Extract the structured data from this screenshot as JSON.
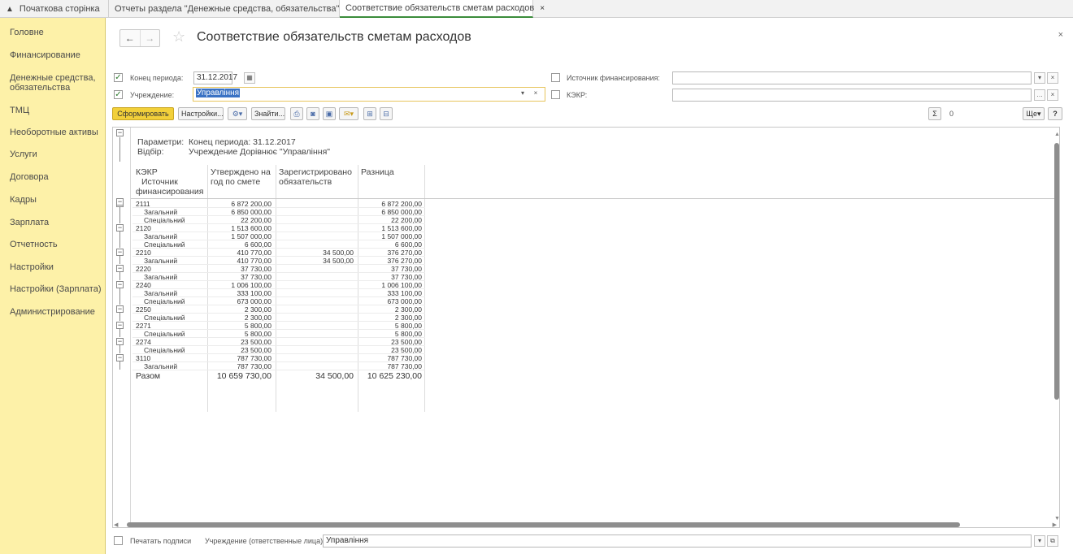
{
  "tabs": [
    {
      "label": "Початкова сторінка",
      "icon": "home-icon"
    },
    {
      "label": "Отчеты раздела \"Денежные средства, обязательства\"",
      "close": "×"
    },
    {
      "label": "Соответствие обязательств сметам расходов",
      "close": "×"
    }
  ],
  "sidebar": {
    "items": [
      "Головне",
      "Финансирование",
      "Денежные средства, обязательства",
      "ТМЦ",
      "Необоротные активы",
      "Услуги",
      "Договора",
      "Кадры",
      "Зарплата",
      "Отчетность",
      "Настройки",
      "Настройки (Зарплата)",
      "Администрирование"
    ]
  },
  "header": {
    "back": "←",
    "forward": "→",
    "star": "☆",
    "title": "Соответствие обязательств сметам расходов",
    "close": "×"
  },
  "filters": {
    "period_label": "Конец периода:",
    "period_value": "31.12.2017",
    "period_checked": true,
    "org_label": "Учреждение:",
    "org_value": "Управління",
    "org_checked": true,
    "source_label": "Источник финансирования:",
    "source_value": "",
    "source_checked": false,
    "kekr_label": "КЭКР:",
    "kekr_value": "",
    "kekr_checked": false
  },
  "toolbar": {
    "generate": "Сформировать",
    "settings": "Настройки...",
    "find": "Знайти...",
    "sum_value": "0",
    "more": "Ще",
    "help": "?"
  },
  "report": {
    "params_label": "Параметри:",
    "params_value": "Конец периода: 31.12.2017",
    "filter_label": "Відбір:",
    "filter_value": "Учреждение Дорівнює \"Управління\"",
    "columns": {
      "c1a": "КЭКР",
      "c1b": "Источник",
      "c1c": "финансирования",
      "c2a": "Утверждено на",
      "c2b": "год по смете",
      "c3a": "Зарегистрировано",
      "c3b": "обязательств",
      "c4": "Разница"
    },
    "rows": [
      {
        "name": "2111",
        "approved": "6 872 200,00",
        "registered": "",
        "diff": "6 872 200,00",
        "level": 0
      },
      {
        "name": "Загальний",
        "approved": "6 850 000,00",
        "registered": "",
        "diff": "6 850 000,00",
        "level": 1
      },
      {
        "name": "Спеціальний",
        "approved": "22 200,00",
        "registered": "",
        "diff": "22 200,00",
        "level": 1
      },
      {
        "name": "2120",
        "approved": "1 513 600,00",
        "registered": "",
        "diff": "1 513 600,00",
        "level": 0
      },
      {
        "name": "Загальний",
        "approved": "1 507 000,00",
        "registered": "",
        "diff": "1 507 000,00",
        "level": 1
      },
      {
        "name": "Спеціальний",
        "approved": "6 600,00",
        "registered": "",
        "diff": "6 600,00",
        "level": 1
      },
      {
        "name": "2210",
        "approved": "410 770,00",
        "registered": "34 500,00",
        "diff": "376 270,00",
        "level": 0
      },
      {
        "name": "Загальний",
        "approved": "410 770,00",
        "registered": "34 500,00",
        "diff": "376 270,00",
        "level": 1
      },
      {
        "name": "2220",
        "approved": "37 730,00",
        "registered": "",
        "diff": "37 730,00",
        "level": 0
      },
      {
        "name": "Загальний",
        "approved": "37 730,00",
        "registered": "",
        "diff": "37 730,00",
        "level": 1
      },
      {
        "name": "2240",
        "approved": "1 006 100,00",
        "registered": "",
        "diff": "1 006 100,00",
        "level": 0
      },
      {
        "name": "Загальний",
        "approved": "333 100,00",
        "registered": "",
        "diff": "333 100,00",
        "level": 1
      },
      {
        "name": "Спеціальний",
        "approved": "673 000,00",
        "registered": "",
        "diff": "673 000,00",
        "level": 1
      },
      {
        "name": "2250",
        "approved": "2 300,00",
        "registered": "",
        "diff": "2 300,00",
        "level": 0
      },
      {
        "name": "Спеціальний",
        "approved": "2 300,00",
        "registered": "",
        "diff": "2 300,00",
        "level": 1
      },
      {
        "name": "2271",
        "approved": "5 800,00",
        "registered": "",
        "diff": "5 800,00",
        "level": 0
      },
      {
        "name": "Спеціальний",
        "approved": "5 800,00",
        "registered": "",
        "diff": "5 800,00",
        "level": 1
      },
      {
        "name": "2274",
        "approved": "23 500,00",
        "registered": "",
        "diff": "23 500,00",
        "level": 0
      },
      {
        "name": "Спеціальний",
        "approved": "23 500,00",
        "registered": "",
        "diff": "23 500,00",
        "level": 1
      },
      {
        "name": "3110",
        "approved": "787 730,00",
        "registered": "",
        "diff": "787 730,00",
        "level": 0
      },
      {
        "name": "Загальний",
        "approved": "787 730,00",
        "registered": "",
        "diff": "787 730,00",
        "level": 1
      }
    ],
    "total": {
      "name": "Разом",
      "approved": "10 659 730,00",
      "registered": "34 500,00",
      "diff": "10 625 230,00"
    }
  },
  "footer": {
    "print_label": "Печатать подписи",
    "print_checked": false,
    "resp_label": "Учреждение (ответственные лица):",
    "resp_value": "Управління"
  }
}
